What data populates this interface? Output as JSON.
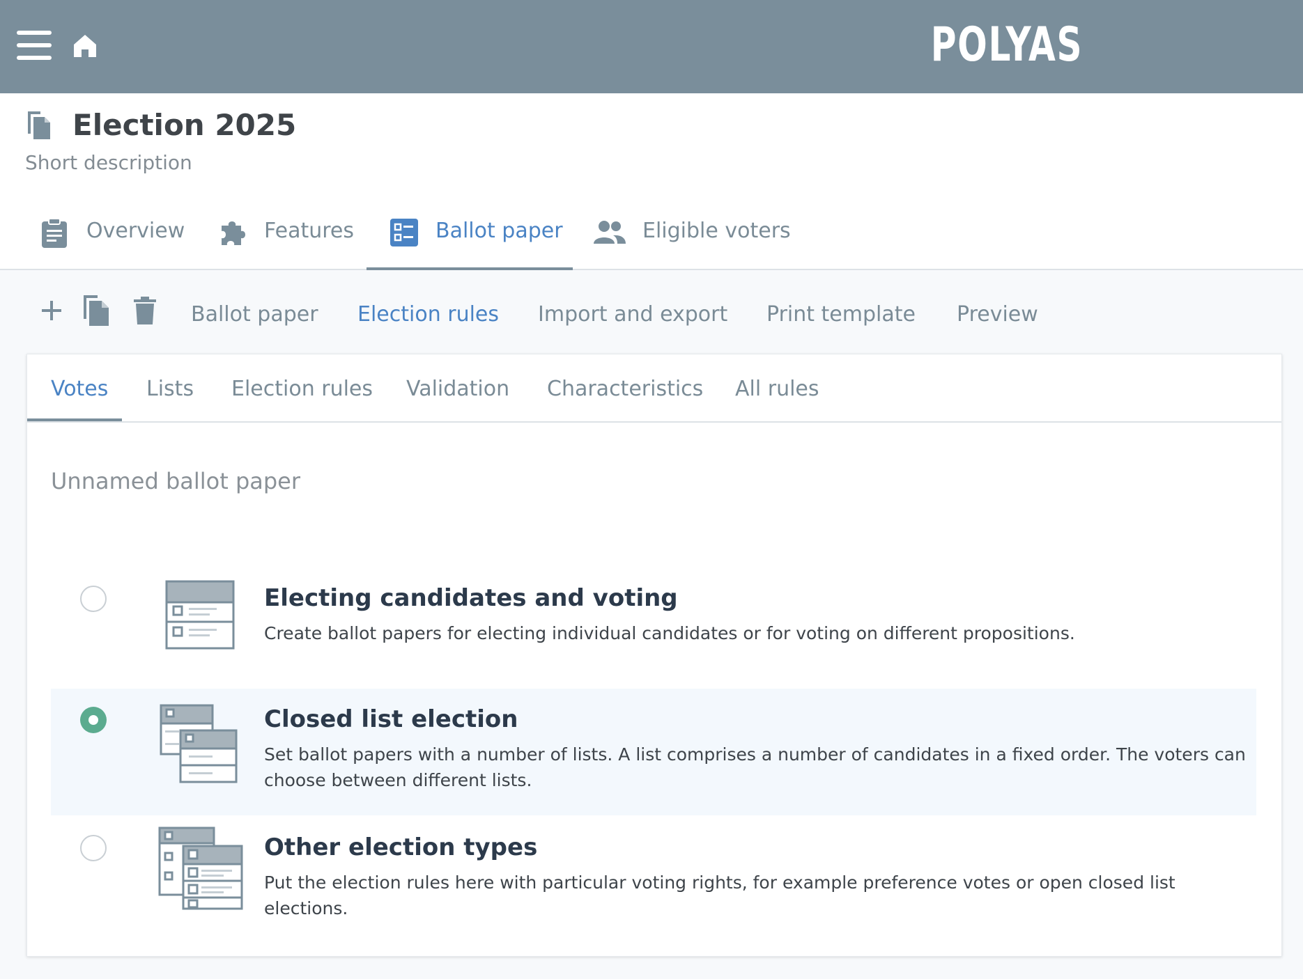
{
  "topbar": {
    "logo": "POLYAS",
    "menu_icon": "hamburger-menu-icon",
    "home_icon": "home-icon",
    "background": "#7a8e9b"
  },
  "header": {
    "title": "Election 2025",
    "subtitle": "Short description",
    "title_icon": "documents-icon"
  },
  "tabs": [
    {
      "label": "Overview",
      "icon": "clipboard-icon",
      "active": false
    },
    {
      "label": "Features",
      "icon": "puzzle-icon",
      "active": false
    },
    {
      "label": "Ballot paper",
      "icon": "ballot-list-icon",
      "active": true
    },
    {
      "label": "Eligible voters",
      "icon": "people-icon",
      "active": false
    }
  ],
  "toolbar": {
    "icons": [
      "plus-icon",
      "copy-icon",
      "trash-icon"
    ],
    "nav": [
      {
        "label": "Ballot paper",
        "active": false
      },
      {
        "label": "Election rules",
        "active": true
      },
      {
        "label": "Import and export",
        "active": false
      },
      {
        "label": "Print template",
        "active": false
      },
      {
        "label": "Preview",
        "active": false
      }
    ]
  },
  "card": {
    "tabs": [
      {
        "label": "Votes",
        "active": true
      },
      {
        "label": "Lists",
        "active": false
      },
      {
        "label": "Election rules",
        "active": false
      },
      {
        "label": "Validation",
        "active": false
      },
      {
        "label": "Characteristics",
        "active": false
      },
      {
        "label": "All rules",
        "active": false
      }
    ],
    "section_title": "Unnamed ballot paper",
    "options": [
      {
        "title": "Electing candidates and voting",
        "description": "Create ballot papers for electing individual candidates or for voting on different propositions.",
        "selected": false,
        "icon": "single-ballot-icon"
      },
      {
        "title": "Closed list election",
        "description": "Set ballot papers with a number of lists. A list comprises a number of candidates in a fixed order. The voters can choose between different lists.",
        "selected": true,
        "icon": "list-ballots-icon"
      },
      {
        "title": "Other election types",
        "description": "Put the election rules here with particular voting rights, for example preference votes or open closed list elections.",
        "selected": false,
        "icon": "multi-ballots-icon"
      }
    ]
  },
  "colors": {
    "accent": "#4a83c4",
    "muted": "#7a8b96",
    "selected_radio": "#5bab8f",
    "selected_bg": "#f3f8fd"
  }
}
